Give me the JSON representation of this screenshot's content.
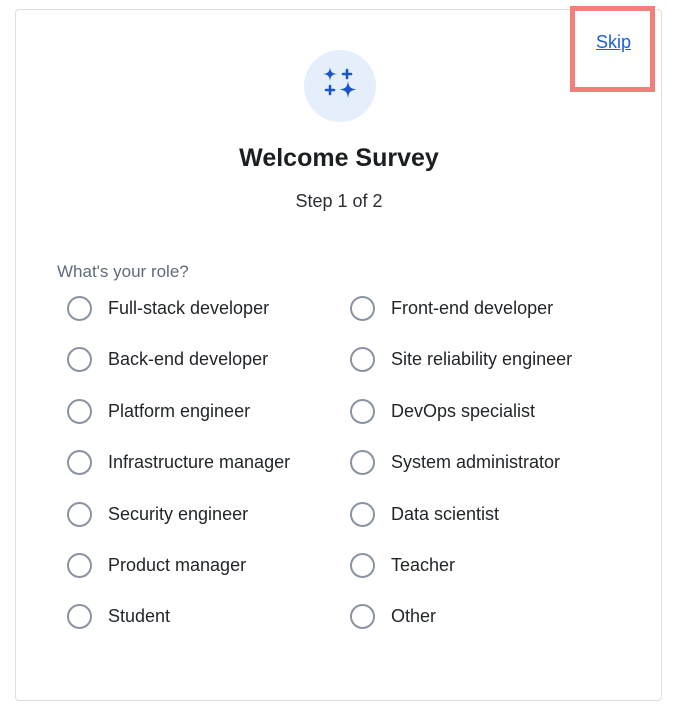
{
  "header": {
    "skip_label": "Skip",
    "icon": "sparkles-icon",
    "title": "Welcome Survey",
    "step": "Step 1 of 2"
  },
  "form": {
    "question": "What's your role?",
    "options": [
      {
        "label": "Full-stack developer",
        "selected": false
      },
      {
        "label": "Front-end developer",
        "selected": false
      },
      {
        "label": "Back-end developer",
        "selected": false
      },
      {
        "label": "Site reliability engineer",
        "selected": false
      },
      {
        "label": "Platform engineer",
        "selected": false
      },
      {
        "label": "DevOps specialist",
        "selected": false
      },
      {
        "label": "Infrastructure manager",
        "selected": false
      },
      {
        "label": "System administrator",
        "selected": false
      },
      {
        "label": "Security engineer",
        "selected": false
      },
      {
        "label": "Data scientist",
        "selected": false
      },
      {
        "label": "Product manager",
        "selected": false
      },
      {
        "label": "Teacher",
        "selected": false
      },
      {
        "label": "Student",
        "selected": false
      },
      {
        "label": "Other",
        "selected": false
      }
    ]
  },
  "colors": {
    "accent": "#1a5fd6",
    "icon_bg": "#e4effb",
    "highlight": "#f37f7a",
    "radio_border": "#8a93a2"
  }
}
